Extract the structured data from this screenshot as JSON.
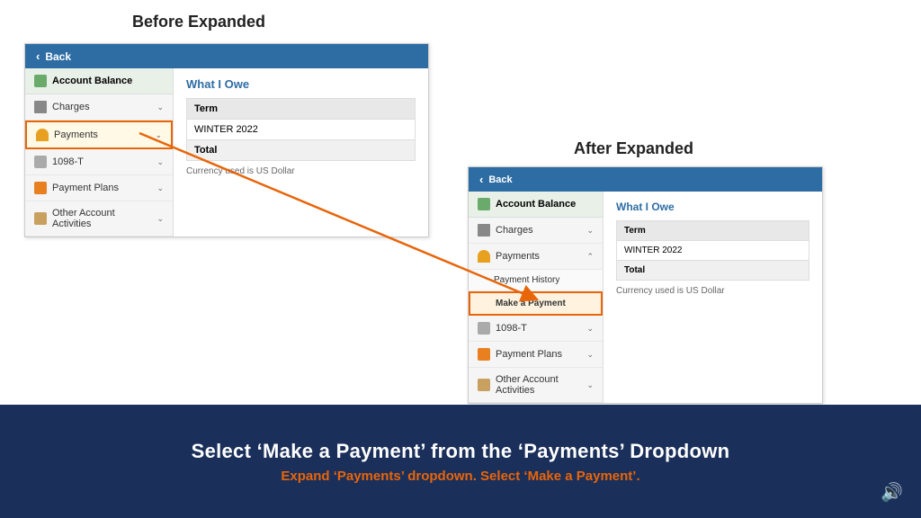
{
  "headings": {
    "before": "Before Expanded",
    "after": "After Expanded"
  },
  "back_label": "Back",
  "before_panel": {
    "sidebar": {
      "items": [
        {
          "label": "Account Balance",
          "icon": "balance",
          "has_chevron": false
        },
        {
          "label": "Charges",
          "icon": "charges",
          "has_chevron": true
        },
        {
          "label": "Payments",
          "icon": "payments",
          "has_chevron": true,
          "highlighted": true
        },
        {
          "label": "1098-T",
          "icon": "1098",
          "has_chevron": true
        },
        {
          "label": "Payment Plans",
          "icon": "plans",
          "has_chevron": true
        },
        {
          "label": "Other Account Activities",
          "icon": "other",
          "has_chevron": true
        }
      ]
    },
    "main": {
      "section_title": "What I Owe",
      "table": {
        "headers": [
          "Term"
        ],
        "rows": [
          [
            "WINTER 2022"
          ]
        ],
        "total_label": "Total"
      },
      "currency_note": "Currency used is US Dollar"
    }
  },
  "after_panel": {
    "sidebar": {
      "items": [
        {
          "label": "Account Balance",
          "icon": "balance",
          "has_chevron": false
        },
        {
          "label": "Charges",
          "icon": "charges",
          "has_chevron": true
        },
        {
          "label": "Payments",
          "icon": "payments",
          "has_chevron": true,
          "expanded": true
        },
        {
          "sub_items": [
            {
              "label": "Payment History"
            },
            {
              "label": "Make a Payment",
              "highlighted": true
            }
          ]
        },
        {
          "label": "1098-T",
          "icon": "1098",
          "has_chevron": true
        },
        {
          "label": "Payment Plans",
          "icon": "plans",
          "has_chevron": true
        },
        {
          "label": "Other Account Activities",
          "icon": "other",
          "has_chevron": true
        }
      ]
    },
    "main": {
      "section_title": "What I Owe",
      "table": {
        "headers": [
          "Term"
        ],
        "rows": [
          [
            "WINTER 2022"
          ]
        ],
        "total_label": "Total"
      },
      "currency_note": "Currency used is US Dollar"
    }
  },
  "bottom_bar": {
    "title": "Select ‘Make a Payment’ from the ‘Payments’ Dropdown",
    "subtitle": "Expand ‘Payments’ dropdown. Select ‘Make a Payment’."
  }
}
